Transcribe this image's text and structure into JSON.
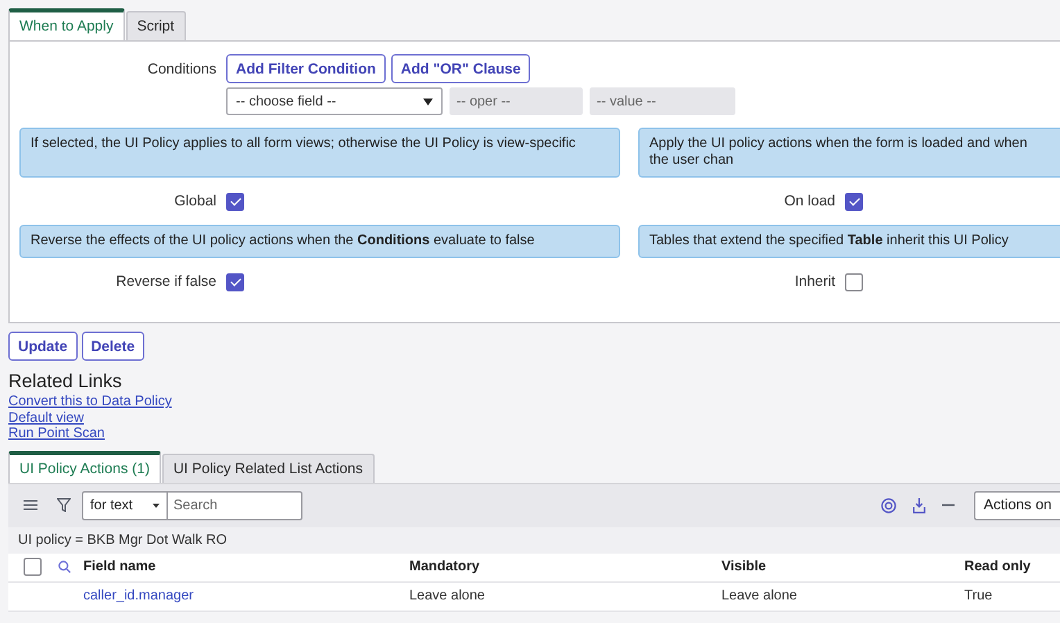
{
  "form_tabs": [
    {
      "label": "When to Apply",
      "selected": true
    },
    {
      "label": "Script",
      "selected": false
    }
  ],
  "conditions": {
    "label": "Conditions",
    "buttons": [
      "Add Filter Condition",
      "Add \"OR\" Clause"
    ],
    "field": {
      "value": "-- choose field --"
    },
    "operator": {
      "placeholder": "-- oper --"
    },
    "value": {
      "placeholder": "-- value --"
    }
  },
  "options": [
    {
      "help": "If selected, the UI Policy applies to all form views; otherwise the UI Policy is view-specific",
      "label": "Global",
      "checked": true
    },
    {
      "help": "Apply the UI policy actions when the form is loaded and when the user chan",
      "label": "On load",
      "checked": true
    },
    {
      "help": "Reverse the effects of the UI policy actions when the **Conditions** evaluate to false",
      "label": "Reverse if false",
      "checked": true
    },
    {
      "help": "Tables that extend the specified **Table** inherit this UI Policy",
      "label": "Inherit",
      "checked": false
    }
  ],
  "form_buttons": [
    "Update",
    "Delete"
  ],
  "related_links": {
    "title": "Related Links",
    "links": [
      "Convert this to Data Policy",
      "Default view",
      "Run Point Scan"
    ]
  },
  "list_tabs": [
    {
      "label": "UI Policy Actions (1)",
      "selected": true
    },
    {
      "label": "UI Policy Related List Actions",
      "selected": false
    }
  ],
  "list_toolbar": {
    "search_field": "for text",
    "search": {
      "placeholder": "Search"
    },
    "actions": "Actions on"
  },
  "filter": "UI policy = BKB Mgr Dot Walk RO",
  "table": {
    "select_all": {
      "checked": false
    },
    "columns": [
      "Field name",
      "Mandatory",
      "Visible",
      "Read only"
    ],
    "rows": [
      {
        "cells": [
          "caller_id.manager",
          "Leave alone",
          "Leave alone",
          "True"
        ]
      }
    ]
  }
}
